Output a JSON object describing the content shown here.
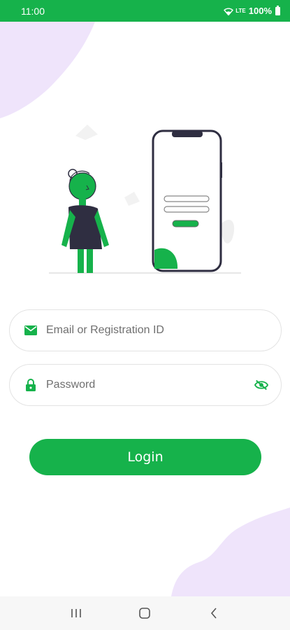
{
  "status_bar": {
    "time": "11:00",
    "network": "LTE",
    "battery": "100%"
  },
  "login_form": {
    "email_placeholder": "Email or Registration ID",
    "password_placeholder": "Password",
    "login_label": "Login"
  },
  "icons": {
    "email": "email-icon",
    "password": "lock-icon",
    "visibility": "eye-off-icon",
    "nav_recents": "recents-icon",
    "nav_home": "home-icon",
    "nav_back": "back-icon"
  },
  "colors": {
    "brand": "#16b24b",
    "blob": "#efe4fb",
    "ink": "#2f2e41"
  }
}
